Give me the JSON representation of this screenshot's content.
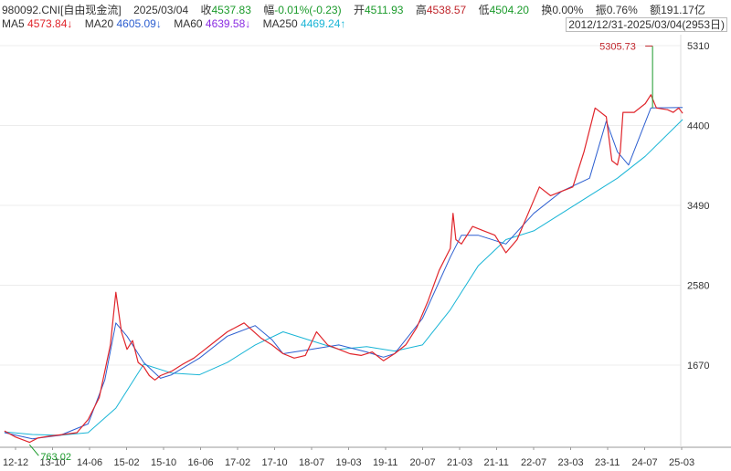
{
  "header": {
    "code": "980092.CNI[自由现金流]",
    "date": "2025/03/04",
    "close_label": "收",
    "close_value": "4537.83",
    "change_label": "幅",
    "change_value": "-0.01%(-0.23)",
    "open_label": "开",
    "open_value": "4511.93",
    "high_label": "高",
    "high_value": "4538.57",
    "low_label": "低",
    "low_value": "4504.20",
    "turnover_label": "换",
    "turnover_value": "0.00%",
    "amplitude_label": "振",
    "amplitude_value": "0.76%",
    "amount_label": "额",
    "amount_value": "191.17亿"
  },
  "ma_legend": [
    {
      "label": "MA5",
      "value": "4573.84↓",
      "color": "#e0252b"
    },
    {
      "label": "MA20",
      "value": "4605.09↓",
      "color": "#2d5fd0"
    },
    {
      "label": "MA60",
      "value": "4639.58↓",
      "color": "#8a2be2"
    },
    {
      "label": "MA250",
      "value": "4469.24↑",
      "color": "#19b5d6"
    }
  ],
  "range_label": "2012/12/31-2025/03/04(2953日)",
  "chart_data": {
    "type": "line",
    "y_ticks": [
      5310,
      4400,
      3490,
      2580,
      1670
    ],
    "ylim": [
      700,
      5450
    ],
    "x_tick_labels": [
      "12-12",
      "13-10",
      "14-06",
      "15-02",
      "15-10",
      "16-06",
      "17-02",
      "17-10",
      "18-07",
      "19-03",
      "19-11",
      "20-07",
      "21-03",
      "21-11",
      "22-07",
      "23-03",
      "23-11",
      "24-07",
      "25-03"
    ],
    "annotations": {
      "max_label": "5305.73",
      "max_value": 5305.73,
      "max_x": 24.63,
      "min_label": "763.02",
      "min_value": 763.02,
      "min_x": 13.45
    },
    "series": [
      {
        "key": "price",
        "color": "#e0252b",
        "x": [
          13.0,
          13.2,
          13.45,
          13.6,
          13.8,
          14.0,
          14.3,
          14.5,
          14.7,
          14.9,
          15.0,
          15.1,
          15.2,
          15.3,
          15.4,
          15.5,
          15.6,
          15.7,
          15.8,
          16.0,
          16.2,
          16.4,
          16.6,
          16.8,
          17.0,
          17.3,
          17.6,
          17.8,
          18.0,
          18.2,
          18.4,
          18.6,
          18.8,
          19.0,
          19.2,
          19.4,
          19.6,
          19.8,
          20.0,
          20.2,
          20.4,
          20.6,
          20.8,
          21.0,
          21.05,
          21.1,
          21.2,
          21.4,
          21.6,
          21.8,
          22.0,
          22.2,
          22.4,
          22.6,
          22.8,
          23.0,
          23.2,
          23.4,
          23.6,
          23.8,
          23.9,
          24.0,
          24.05,
          24.1,
          24.3,
          24.5,
          24.6,
          24.7,
          24.9,
          25.0,
          25.1,
          25.17
        ],
        "values": [
          920,
          850,
          790,
          840,
          860,
          875,
          900,
          1050,
          1300,
          1900,
          2500,
          2050,
          1850,
          1950,
          1700,
          1650,
          1550,
          1500,
          1550,
          1600,
          1680,
          1750,
          1850,
          1950,
          2050,
          2150,
          1980,
          1900,
          1800,
          1750,
          1780,
          2050,
          1900,
          1850,
          1800,
          1780,
          1820,
          1720,
          1800,
          1900,
          2100,
          2400,
          2750,
          3000,
          3400,
          3100,
          3050,
          3250,
          3200,
          3150,
          2950,
          3100,
          3400,
          3700,
          3600,
          3650,
          3700,
          4100,
          4600,
          4500,
          4000,
          3950,
          4100,
          4550,
          4550,
          4650,
          4750,
          4600,
          4580,
          4550,
          4600,
          4538
        ]
      },
      {
        "key": "ma20",
        "color": "#2d5fd0",
        "x": [
          13.0,
          13.5,
          14.0,
          14.5,
          14.8,
          15.0,
          15.2,
          15.5,
          15.8,
          16.0,
          16.5,
          17.0,
          17.5,
          17.8,
          18.0,
          18.5,
          19.0,
          19.5,
          19.8,
          20.0,
          20.5,
          21.0,
          21.2,
          21.5,
          22.0,
          22.5,
          23.0,
          23.5,
          23.8,
          24.0,
          24.2,
          24.6,
          25.17
        ],
        "values": [
          900,
          830,
          870,
          1000,
          1500,
          2150,
          2000,
          1700,
          1520,
          1560,
          1750,
          2000,
          2120,
          1960,
          1800,
          1850,
          1900,
          1820,
          1760,
          1800,
          2200,
          2900,
          3150,
          3150,
          3050,
          3400,
          3650,
          3800,
          4450,
          4100,
          3950,
          4600,
          4605
        ]
      },
      {
        "key": "ma250",
        "color": "#19b5d6",
        "x": [
          13.0,
          13.5,
          14.0,
          14.5,
          15.0,
          15.5,
          16.0,
          16.5,
          17.0,
          17.5,
          18.0,
          18.5,
          19.0,
          19.5,
          20.0,
          20.5,
          21.0,
          21.5,
          22.0,
          22.5,
          23.0,
          23.5,
          24.0,
          24.5,
          25.17
        ],
        "values": [
          910,
          880,
          870,
          900,
          1180,
          1680,
          1580,
          1560,
          1700,
          1900,
          2050,
          1950,
          1850,
          1880,
          1830,
          1900,
          2300,
          2800,
          3100,
          3200,
          3400,
          3600,
          3800,
          4050,
          4469
        ]
      }
    ]
  }
}
